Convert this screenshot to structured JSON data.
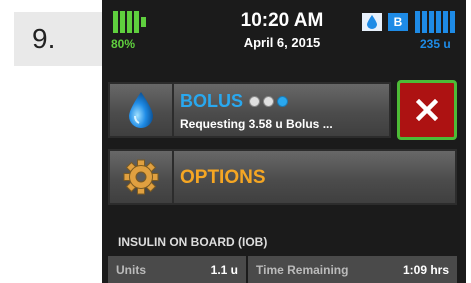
{
  "step": {
    "label": "9."
  },
  "status": {
    "battery_percent": "80%",
    "battery_level": 0.8,
    "time": "10:20 AM",
    "date": "April 6, 2015",
    "bluetooth_badge": "B",
    "reservoir_amount": "235 u"
  },
  "bolus": {
    "title": "BOLUS",
    "subtitle": "Requesting 3.58 u Bolus ...",
    "progress_dots": [
      false,
      false,
      true
    ],
    "icon": "insulin-drop-icon"
  },
  "cancel": {
    "icon": "close-icon",
    "label": "X"
  },
  "options": {
    "label": "OPTIONS",
    "icon": "gear-icon"
  },
  "iob": {
    "title": "INSULIN ON BOARD (IOB)",
    "units_label": "Units",
    "units_value": "1.1 u",
    "time_label": "Time Remaining",
    "time_value": "1:09 hrs"
  },
  "colors": {
    "battery": "#5fcf3e",
    "accent_blue": "#1e8be6",
    "bolus_title": "#29a8ef",
    "options_text": "#f5a623",
    "cancel_bg": "#ad1212",
    "cancel_border": "#4dbb37"
  }
}
